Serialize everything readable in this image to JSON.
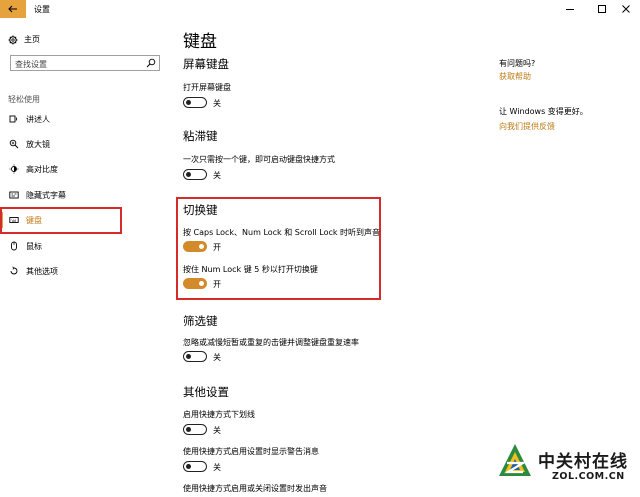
{
  "window": {
    "title": "设置"
  },
  "sidebar": {
    "home_label": "主页",
    "search_placeholder": "查找设置",
    "category": "轻松使用",
    "items": [
      {
        "label": "讲述人",
        "icon": "narrator-icon"
      },
      {
        "label": "放大镜",
        "icon": "magnifier-icon"
      },
      {
        "label": "高对比度",
        "icon": "high-contrast-icon"
      },
      {
        "label": "隐藏式字幕",
        "icon": "closed-captions-icon"
      },
      {
        "label": "键盘",
        "icon": "keyboard-icon",
        "active": true
      },
      {
        "label": "鼠标",
        "icon": "mouse-icon"
      },
      {
        "label": "其他选项",
        "icon": "other-options-icon"
      }
    ]
  },
  "main": {
    "title": "键盘",
    "sections": [
      {
        "heading": "屏幕键盘",
        "settings": [
          {
            "desc": "打开屏幕键盘",
            "state": "关",
            "on": false
          }
        ]
      },
      {
        "heading": "粘滞键",
        "settings": [
          {
            "desc": "一次只需按一个键，即可启动键盘快捷方式",
            "state": "关",
            "on": false
          }
        ]
      },
      {
        "heading": "切换键",
        "settings": [
          {
            "desc": "按 Caps Lock、Num Lock 和 Scroll Lock 时听到声音",
            "state": "开",
            "on": true
          },
          {
            "desc": "按住 Num Lock 键 5 秒以打开切换键",
            "state": "开",
            "on": true
          }
        ]
      },
      {
        "heading": "筛选键",
        "settings": [
          {
            "desc": "忽略或减慢短暂或重复的击键并调整键盘重复速率",
            "state": "关",
            "on": false
          }
        ]
      },
      {
        "heading": "其他设置",
        "settings": [
          {
            "desc": "启用快捷方式下划线",
            "state": "关",
            "on": false
          },
          {
            "desc": "使用快捷方式启用设置时显示警告消息",
            "state": "关",
            "on": false
          },
          {
            "desc": "使用快捷方式启用或关闭设置时发出声音",
            "state": "",
            "on": false
          }
        ]
      }
    ]
  },
  "right": {
    "question": "有问题吗?",
    "help_link": "获取帮助",
    "improve": "让 Windows 变得更好。",
    "feedback_link": "向我们提供反馈"
  },
  "watermark": {
    "cn": "中关村在线",
    "en": "ZOL.COM.CN"
  },
  "colors": {
    "accent": "#d38a2a",
    "highlight": "#d52b2b",
    "link": "#c07a16"
  }
}
